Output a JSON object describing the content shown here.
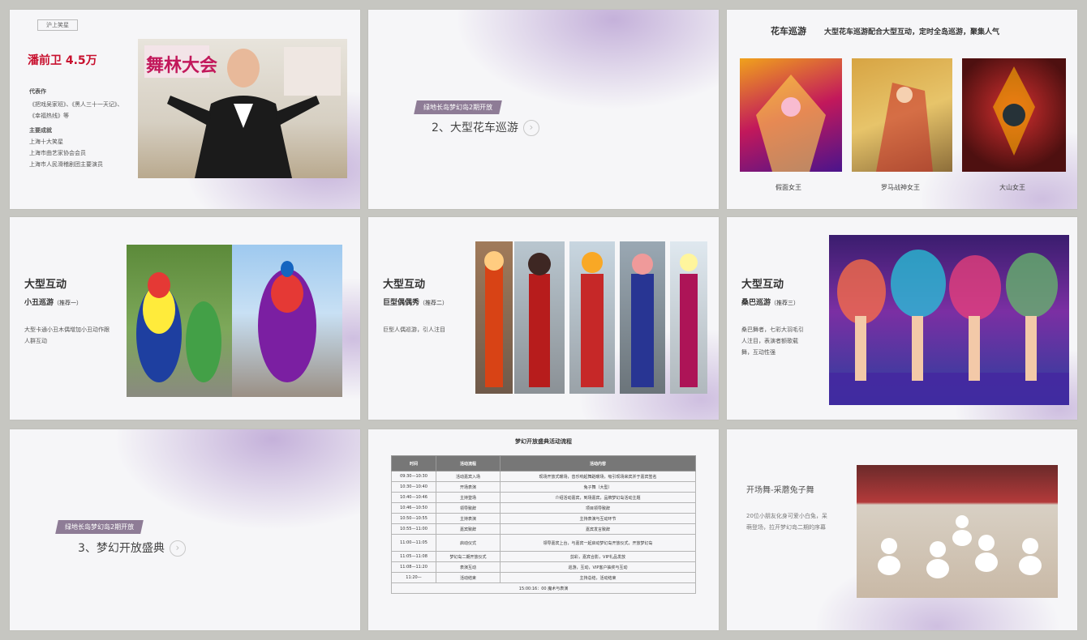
{
  "slides": {
    "s1": {
      "tag": "沪上笑星",
      "name_value": "潘前卫 4.5万",
      "works_heading": "代表作",
      "works_text": [
        "《把戏吴家班》、《黑人三十一天记》、《幸福热线》等"
      ],
      "honors_heading": "主要成就",
      "honors": [
        "上海十大笑星",
        "上海市曲艺家协会会员",
        "上海市人民滑稽剧团主要演员"
      ]
    },
    "s2": {
      "badge": "绿地长岛梦幻岛2期开放",
      "title": "2、大型花车巡游"
    },
    "s3": {
      "heading": "花车巡游",
      "subtitle": "大型花车巡游配合大型互动，定时全岛巡游，聚集人气",
      "captions": [
        "假面女王",
        "罗马战神女王",
        "大山女王"
      ]
    },
    "s4": {
      "heading": "大型互动",
      "sub": "小丑巡游",
      "sub_tag": "（推荐一）",
      "desc": "大型卡通小丑木偶增加小丑动作跟人群互动"
    },
    "s5": {
      "heading": "大型互动",
      "sub": "巨型偶偶秀",
      "sub_tag": "（推荐二）",
      "desc": "巨型人偶巡游，引人注目"
    },
    "s6": {
      "heading": "大型互动",
      "sub": "桑巴巡游",
      "sub_tag": "（推荐三）",
      "desc": "桑巴舞者，七彩大羽毛引人注目，表演者额歌载舞，互动性强"
    },
    "s7": {
      "badge": "绿地长岛梦幻岛2期开放",
      "title": "3、梦幻开放盛典"
    },
    "s8": {
      "heading": "梦幻开放盛典活动流程",
      "columns": [
        "时间",
        "活动流程",
        "活动内容"
      ],
      "rows": [
        [
          "09:30—10:30",
          "活动嘉宾入场",
          "现场开放式暖场，音乐响起舞蹈暖场，吸引现场来宾并于嘉宾签名"
        ],
        [
          "10:30—10:40",
          "开场表演",
          "兔子舞（大型）"
        ],
        [
          "10:40—10:46",
          "主持登场",
          "介绍活动嘉宾，到场嘉宾，品牌梦幻岛活动主题"
        ],
        [
          "10:46—10:50",
          "领导致辞",
          "项目领导致辞"
        ],
        [
          "10:50—10:55",
          "主持表演",
          "主持表演与互动环节"
        ],
        [
          "10:55—11:00",
          "嘉宾致辞",
          "嘉宾发言致辞"
        ],
        [
          "11:00—11:05",
          "启动仪式",
          "领导嘉宾上台，与嘉宾一起启动梦幻岛开放仪式，开放梦幻岛"
        ],
        [
          "11:05—11:08",
          "梦幻岛二期开放仪式",
          "剪彩，嘉宾合影，VIP礼品发放"
        ],
        [
          "11:08—11:20",
          "表演互动",
          "巡游，互动，VIP客户抽奖与互动"
        ],
        [
          "11:20—",
          "活动结束",
          "主持总结，活动结束"
        ]
      ],
      "footer": "15:00:16：00 魔术与表演"
    },
    "s9": {
      "title": "开场舞-采蘑兔子舞",
      "desc": "20位小朋友化身可爱小白兔，呆萌登场，拉开梦幻岛二期的序幕"
    }
  },
  "colors": {
    "accent_red": "#c8102e",
    "badge_purple": "#8e7c96",
    "lavender": "#b49ad0"
  }
}
